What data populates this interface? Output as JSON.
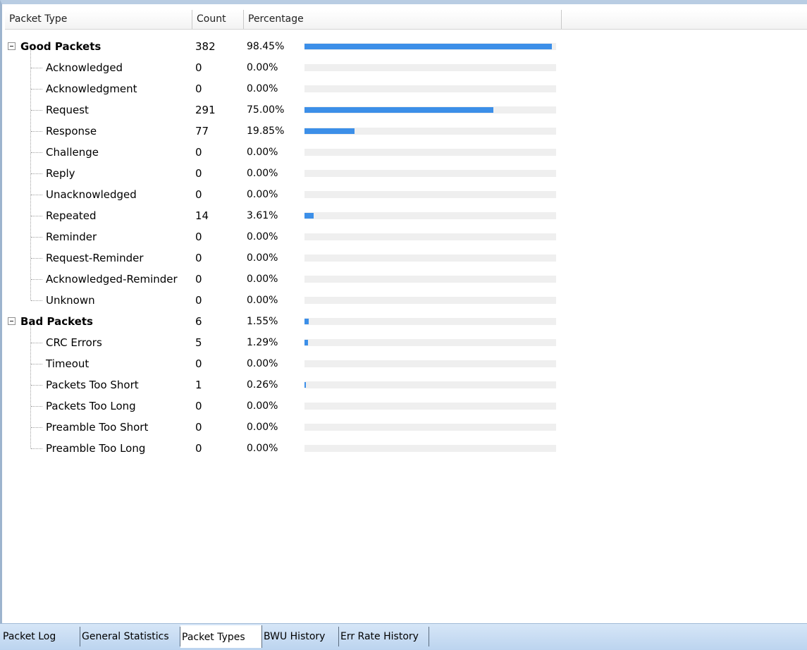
{
  "columns": {
    "type": "Packet Type",
    "count": "Count",
    "percentage": "Percentage"
  },
  "groups": [
    {
      "label": "Good Packets",
      "count": "382",
      "percentage": "98.45%",
      "fraction": 0.9845,
      "items": [
        {
          "label": "Acknowledged",
          "count": "0",
          "percentage": "0.00%",
          "fraction": 0
        },
        {
          "label": "Acknowledgment",
          "count": "0",
          "percentage": "0.00%",
          "fraction": 0
        },
        {
          "label": "Request",
          "count": "291",
          "percentage": "75.00%",
          "fraction": 0.75
        },
        {
          "label": "Response",
          "count": "77",
          "percentage": "19.85%",
          "fraction": 0.1985
        },
        {
          "label": "Challenge",
          "count": "0",
          "percentage": "0.00%",
          "fraction": 0
        },
        {
          "label": "Reply",
          "count": "0",
          "percentage": "0.00%",
          "fraction": 0
        },
        {
          "label": "Unacknowledged",
          "count": "0",
          "percentage": "0.00%",
          "fraction": 0
        },
        {
          "label": "Repeated",
          "count": "14",
          "percentage": "3.61%",
          "fraction": 0.0361
        },
        {
          "label": "Reminder",
          "count": "0",
          "percentage": "0.00%",
          "fraction": 0
        },
        {
          "label": "Request-Reminder",
          "count": "0",
          "percentage": "0.00%",
          "fraction": 0
        },
        {
          "label": "Acknowledged-Reminder",
          "count": "0",
          "percentage": "0.00%",
          "fraction": 0
        },
        {
          "label": "Unknown",
          "count": "0",
          "percentage": "0.00%",
          "fraction": 0
        }
      ]
    },
    {
      "label": "Bad Packets",
      "count": "6",
      "percentage": "1.55%",
      "fraction": 0.0155,
      "items": [
        {
          "label": "CRC Errors",
          "count": "5",
          "percentage": "1.29%",
          "fraction": 0.0129
        },
        {
          "label": "Timeout",
          "count": "0",
          "percentage": "0.00%",
          "fraction": 0
        },
        {
          "label": "Packets Too Short",
          "count": "1",
          "percentage": "0.26%",
          "fraction": 0.0026
        },
        {
          "label": "Packets Too Long",
          "count": "0",
          "percentage": "0.00%",
          "fraction": 0
        },
        {
          "label": "Preamble Too Short",
          "count": "0",
          "percentage": "0.00%",
          "fraction": 0
        },
        {
          "label": "Preamble Too Long",
          "count": "0",
          "percentage": "0.00%",
          "fraction": 0
        }
      ]
    }
  ],
  "tabs": [
    {
      "label": "Packet Log",
      "active": false
    },
    {
      "label": "General Statistics",
      "active": false
    },
    {
      "label": "Packet Types",
      "active": true
    },
    {
      "label": "BWU History",
      "active": false
    },
    {
      "label": "Err Rate History",
      "active": false
    }
  ],
  "colors": {
    "bar": "#3c8fe8",
    "track": "#efefef"
  }
}
